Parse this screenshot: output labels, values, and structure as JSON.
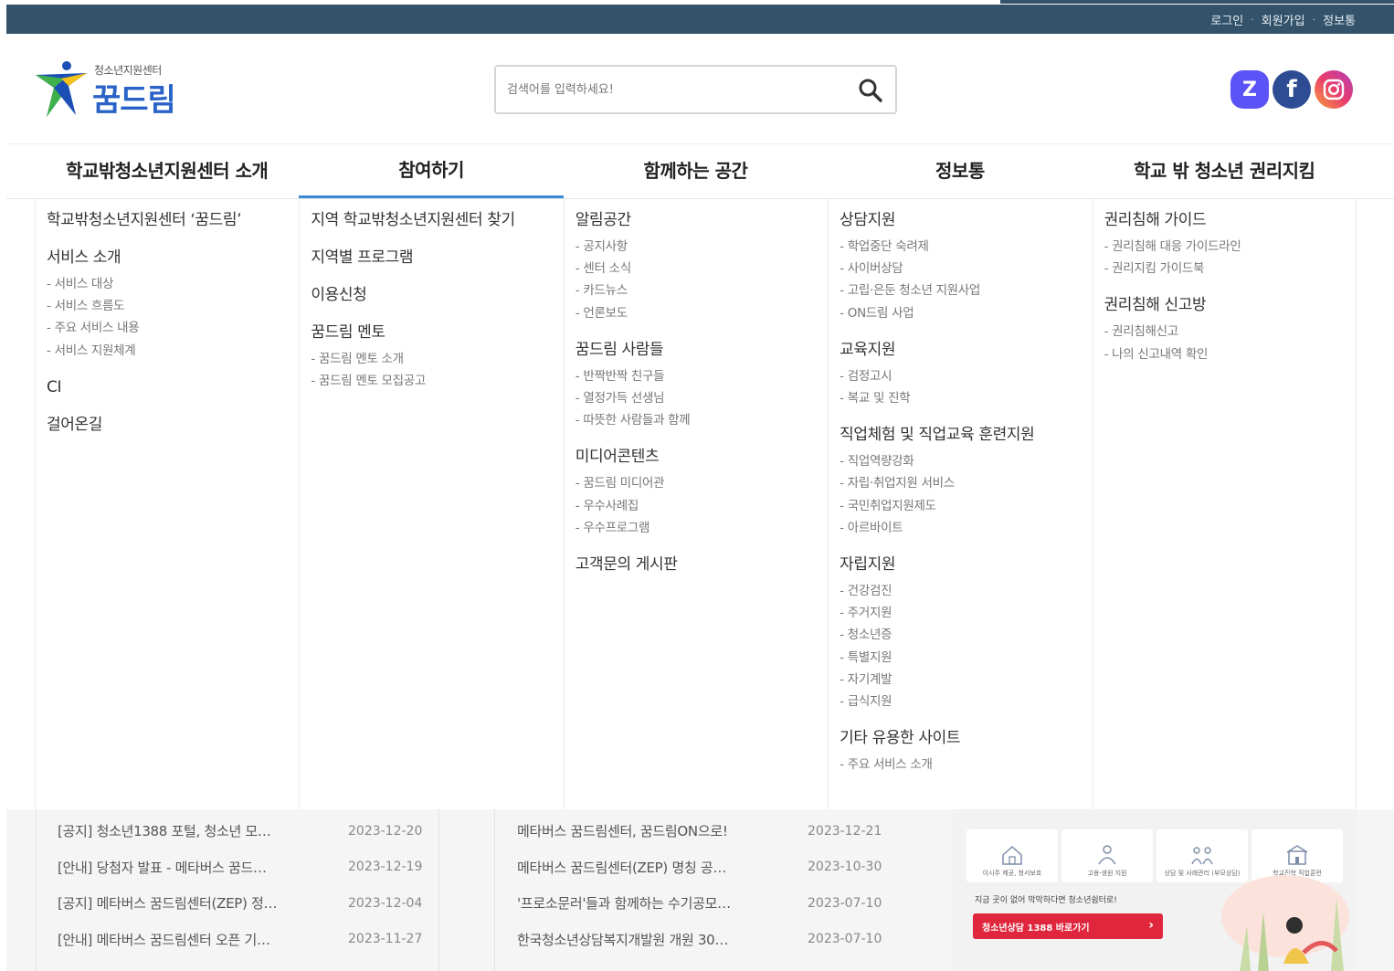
{
  "topbar": {
    "links": [
      "로그인",
      "회원가입",
      "정보통"
    ]
  },
  "header": {
    "logo_subtitle": "청소년지원센터",
    "logo_title": "꿈드림",
    "search_placeholder": "검색어를 입력하세요!",
    "social": [
      {
        "name": "zep",
        "glyph": "Z"
      },
      {
        "name": "facebook",
        "glyph": "f"
      },
      {
        "name": "instagram",
        "glyph": ""
      }
    ]
  },
  "nav": {
    "active_index": 1,
    "menus": [
      "학교밖청소년지원센터 소개",
      "참여하기",
      "함께하는 공간",
      "정보통",
      "학교 밖 청소년 권리지킴"
    ]
  },
  "mega": [
    {
      "groups": [
        {
          "title": "학교밖청소년지원센터 ‘꿈드림’",
          "items": []
        },
        {
          "title": "서비스 소개",
          "items": [
            "서비스 대상",
            "서비스 흐름도",
            "주요 서비스 내용",
            "서비스 지원체계"
          ]
        },
        {
          "title": "CI",
          "items": []
        },
        {
          "title": "걸어온길",
          "items": []
        }
      ]
    },
    {
      "groups": [
        {
          "title": "지역 학교밖청소년지원센터 찾기",
          "items": []
        },
        {
          "title": "지역별 프로그램",
          "items": []
        },
        {
          "title": "이용신청",
          "items": []
        },
        {
          "title": "꿈드림 멘토",
          "items": [
            "꿈드림 멘토 소개",
            "꿈드림 멘토 모집공고"
          ]
        }
      ]
    },
    {
      "groups": [
        {
          "title": "알림공간",
          "items": [
            "공지사항",
            "센터 소식",
            "카드뉴스",
            "언론보도"
          ]
        },
        {
          "title": "꿈드림 사람들",
          "items": [
            "반짝반짝 친구들",
            "열정가득 선생님",
            "따뜻한 사람들과 함께"
          ]
        },
        {
          "title": "미디어콘텐츠",
          "items": [
            "꿈드림 미디어관",
            "우수사례집",
            "우수프로그램"
          ]
        },
        {
          "title": "고객문의 게시판",
          "items": []
        }
      ]
    },
    {
      "groups": [
        {
          "title": "상담지원",
          "items": [
            "학업중단 숙려제",
            "사이버상담",
            "고립·은둔 청소년 지원사업",
            "ON드림 사업"
          ]
        },
        {
          "title": "교육지원",
          "items": [
            "검정고시",
            "복교 및 진학"
          ]
        },
        {
          "title": "직업체험 및 직업교육 훈련지원",
          "items": [
            "직업역량강화",
            "자립·취업지원 서비스",
            "국민취업지원제도",
            "아르바이트"
          ]
        },
        {
          "title": "자립지원",
          "items": [
            "건강검진",
            "주거지원",
            "청소년증",
            "특별지원",
            "자기계발",
            "급식지원"
          ]
        },
        {
          "title": "기타 유용한 사이트",
          "items": [
            "주요 서비스 소개"
          ]
        }
      ]
    },
    {
      "groups": [
        {
          "title": "권리침해 가이드",
          "items": [
            "권리침해 대응 가이드라인",
            "권리지킴 가이드북"
          ]
        },
        {
          "title": "권리침해 신고방",
          "items": [
            "권리침해신고",
            "나의 신고내역 확인"
          ]
        }
      ]
    }
  ],
  "boards": [
    {
      "rows": [
        {
          "title": "[공지] 청소년1388 포털, 청소년 모…",
          "date": "2023-12-20"
        },
        {
          "title": "[안내] 당첨자 발표 - 메타버스 꿈드…",
          "date": "2023-12-19"
        },
        {
          "title": "[공지] 메타버스 꿈드림센터(ZEP) 정…",
          "date": "2023-12-04"
        },
        {
          "title": "[안내] 메타버스 꿈드림센터 오픈 기…",
          "date": "2023-11-27"
        }
      ]
    },
    {
      "rows": [
        {
          "title": "메타버스 꿈드림센터, 꿈드림ON으로!",
          "date": "2023-12-21"
        },
        {
          "title": "메타버스 꿈드림센터(ZEP) 명칭 공…",
          "date": "2023-10-30"
        },
        {
          "title": "'프로소문러'들과 함께하는 수기공모…",
          "date": "2023-07-10"
        },
        {
          "title": "한국청소년상담복지개발원 개원 30…",
          "date": "2023-07-10"
        }
      ]
    }
  ],
  "banner": {
    "tiles": [
      "이시주 제공, 청서보호",
      "고용·생원 지원",
      "상담 및 사례관리 (부모상담)",
      "학교진학 직업훈련"
    ],
    "message": "지금 곳이 없어 막막하다면 청소년쉼터로!",
    "cta_label": "청소년상담 1388 바로가기",
    "cta_arrow": "›"
  }
}
